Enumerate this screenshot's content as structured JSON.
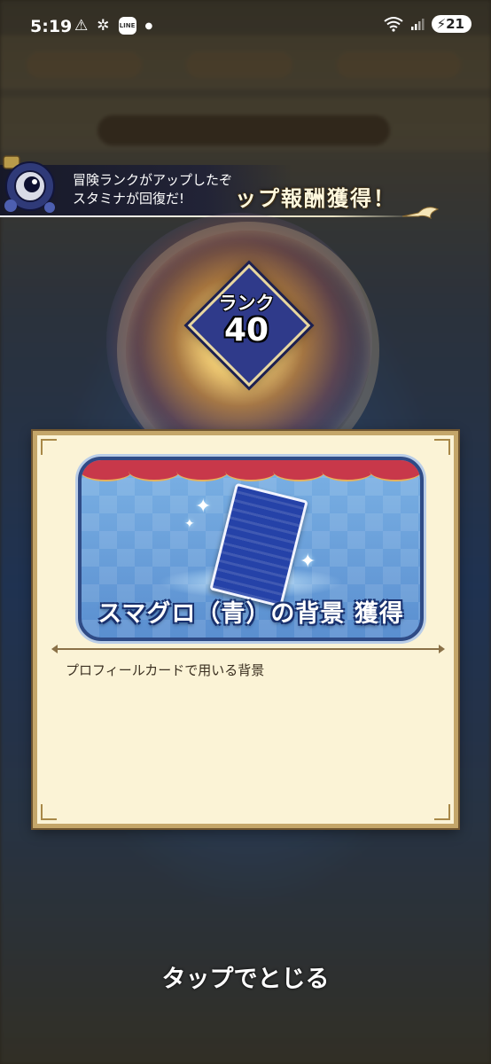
{
  "status_bar": {
    "time": "5:19",
    "battery": "21",
    "line_badge": "LINE",
    "icons": [
      "warning-icon",
      "pinwheel-icon",
      "line-app-icon",
      "dot-icon",
      "wifi-icon",
      "signal-icon",
      "battery-icon"
    ]
  },
  "notification": {
    "line1": "冒険ランクがアップしたぞ",
    "line2": "スタミナが回復だ!",
    "header": "ップ報酬獲得！"
  },
  "rank": {
    "label": "ランク",
    "value": "40"
  },
  "reward": {
    "title": "スマグロ（青）の背景 獲得",
    "description": "プロフィールカードで用いる背景"
  },
  "footer": {
    "tap_to_close": "タップでとじる"
  },
  "colors": {
    "panel": "#fbf3d6",
    "panel_border": "#c4a66a",
    "card_blue": "#5a8fd0",
    "curtain_red": "#c8384a",
    "rank_diamond": "#2f3a8a"
  }
}
